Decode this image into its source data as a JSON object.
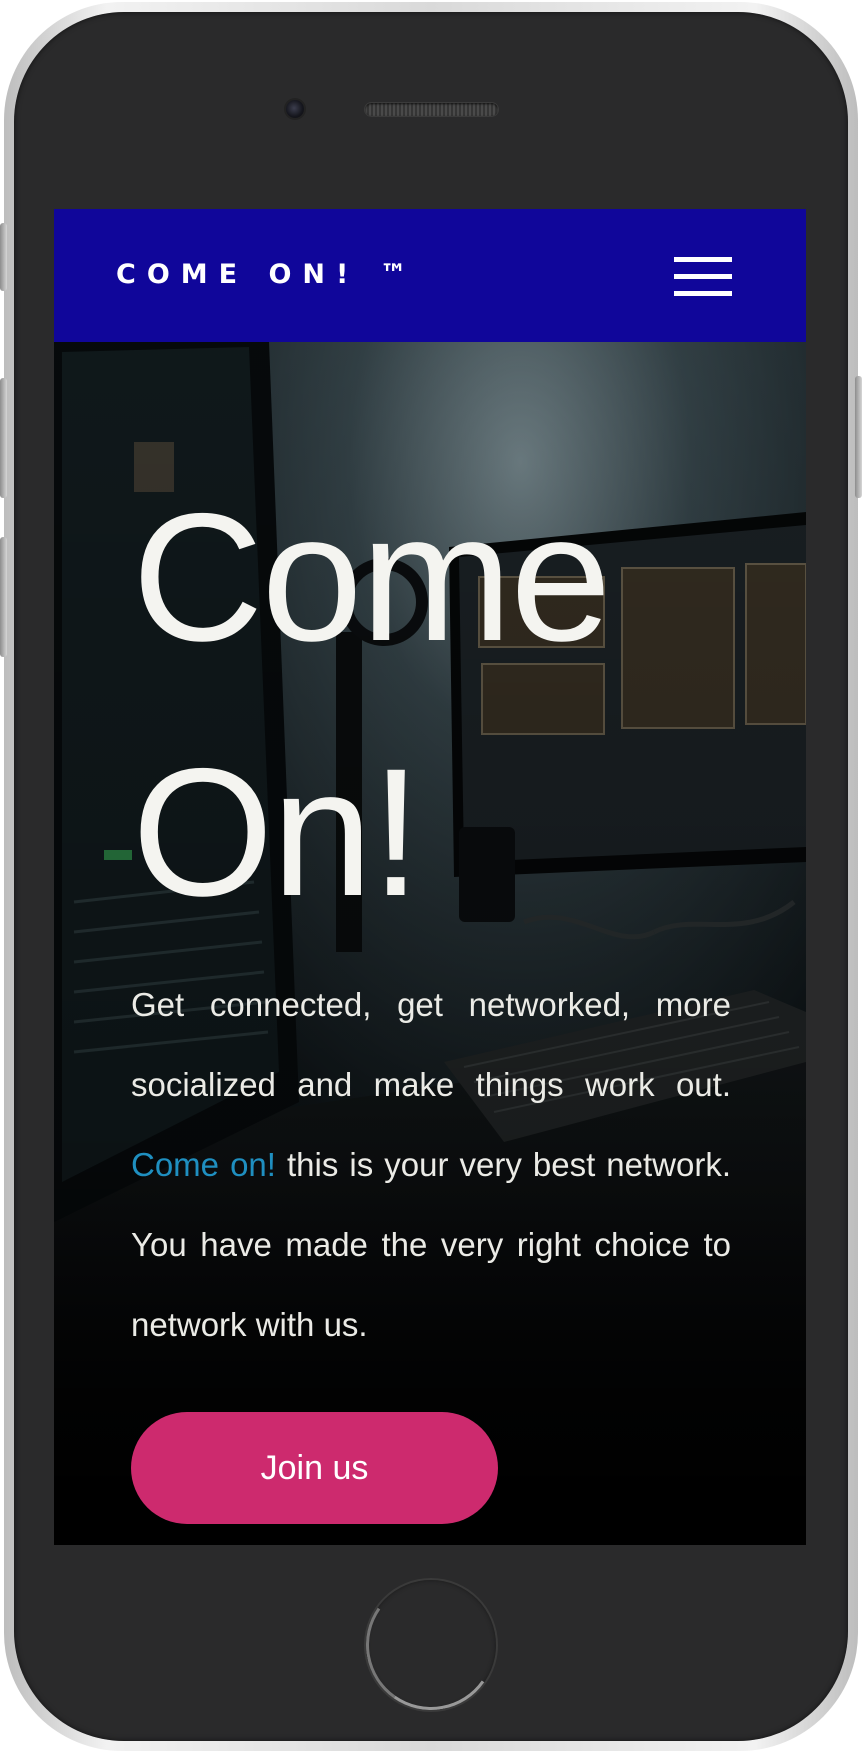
{
  "navbar": {
    "brand": "COME ON! ™",
    "menu_icon": "hamburger-menu-icon",
    "background": "#10069a"
  },
  "hero": {
    "title_line1": "Come",
    "title_line2": "On!",
    "text_part1": "Get connected, get networked, more socialized and make things work out. ",
    "text_accent": "Come on!",
    "text_part2": " this is your very best network. You have made the very right choice to network with us.",
    "cta_label": "Join us"
  },
  "colors": {
    "accent_text": "#1f8fc0",
    "cta_background": "#cd2a6e",
    "title_text": "#f4f4f0"
  }
}
